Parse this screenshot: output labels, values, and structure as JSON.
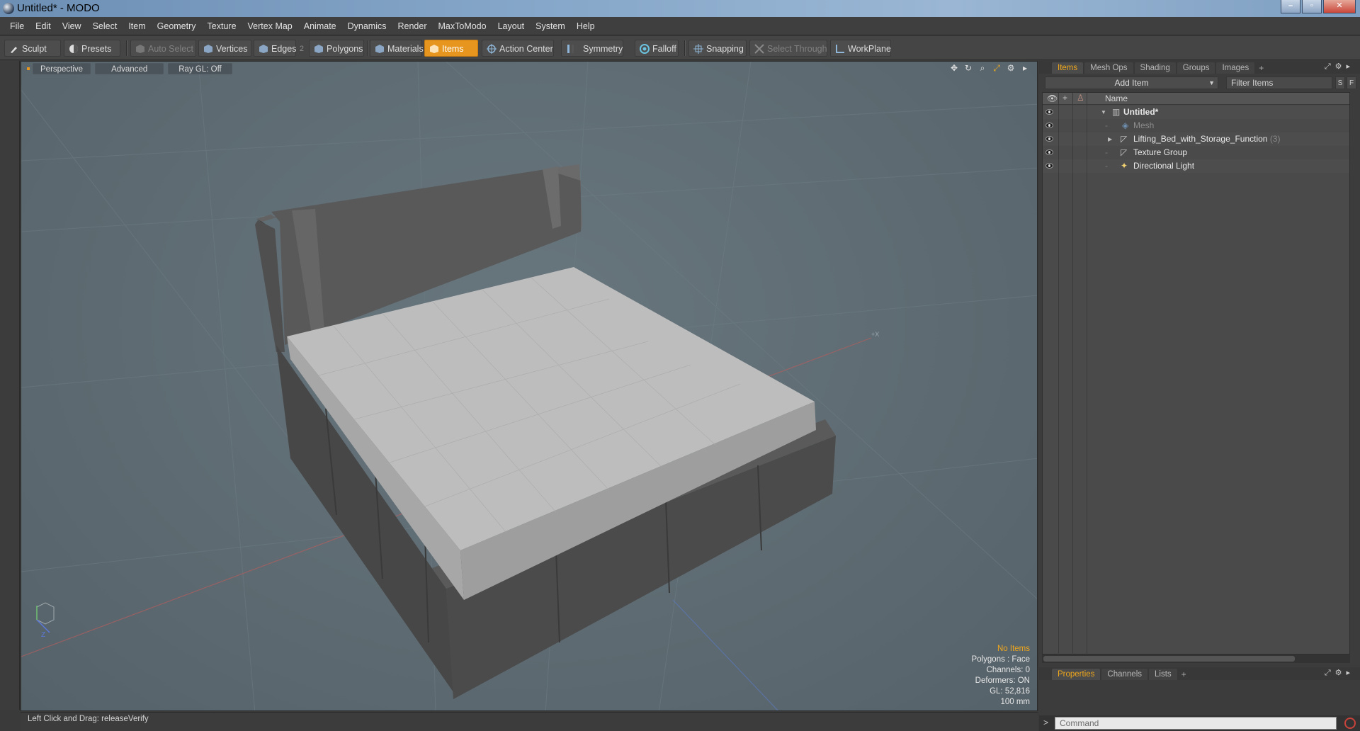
{
  "window": {
    "title": "Untitled* - MODO"
  },
  "menu": [
    "File",
    "Edit",
    "View",
    "Select",
    "Item",
    "Geometry",
    "Texture",
    "Vertex Map",
    "Animate",
    "Dynamics",
    "Render",
    "MaxToModo",
    "Layout",
    "System",
    "Help"
  ],
  "toolbar": {
    "sculpt": "Sculpt",
    "presets": "Presets",
    "auto_select": "Auto Select",
    "vertices": "Vertices",
    "edges": "Edges",
    "edges_count": "2",
    "polygons": "Polygons",
    "materials": "Materials",
    "items": "Items",
    "action_center": "Action Center",
    "symmetry": "Symmetry",
    "falloff": "Falloff",
    "snapping": "Snapping",
    "select_through": "Select Through",
    "workplane": "WorkPlane"
  },
  "viewport": {
    "view": "Perspective",
    "style": "Advanced",
    "raygl": "Ray GL: Off",
    "stats": {
      "items": "No Items",
      "polygons": "Polygons : Face",
      "channels": "Channels: 0",
      "deformers": "Deformers: ON",
      "gl": "GL: 52,816",
      "grid": "100 mm"
    }
  },
  "statusbar": {
    "hint": "Left Click and Drag:  releaseVerify"
  },
  "panel": {
    "tabs": [
      "Items",
      "Mesh Ops",
      "Shading",
      "Groups",
      "Images"
    ],
    "add_item": "Add Item",
    "filter_placeholder": "Filter Items",
    "btn_s": "S",
    "btn_f": "F",
    "col_name": "Name",
    "tree": [
      {
        "label": "Untitled*",
        "count": ""
      },
      {
        "label": "Mesh",
        "count": ""
      },
      {
        "label": "Lifting_Bed_with_Storage_Function",
        "count": "(3)"
      },
      {
        "label": "Texture Group",
        "count": ""
      },
      {
        "label": "Directional Light",
        "count": ""
      }
    ],
    "bottom_tabs": [
      "Properties",
      "Channels",
      "Lists"
    ],
    "command_placeholder": "Command",
    "command_prompt": ">"
  },
  "colors": {
    "accent": "#e6951f",
    "viewport_bg": "#5f6c73",
    "panel_bg": "#3c3c3c"
  }
}
